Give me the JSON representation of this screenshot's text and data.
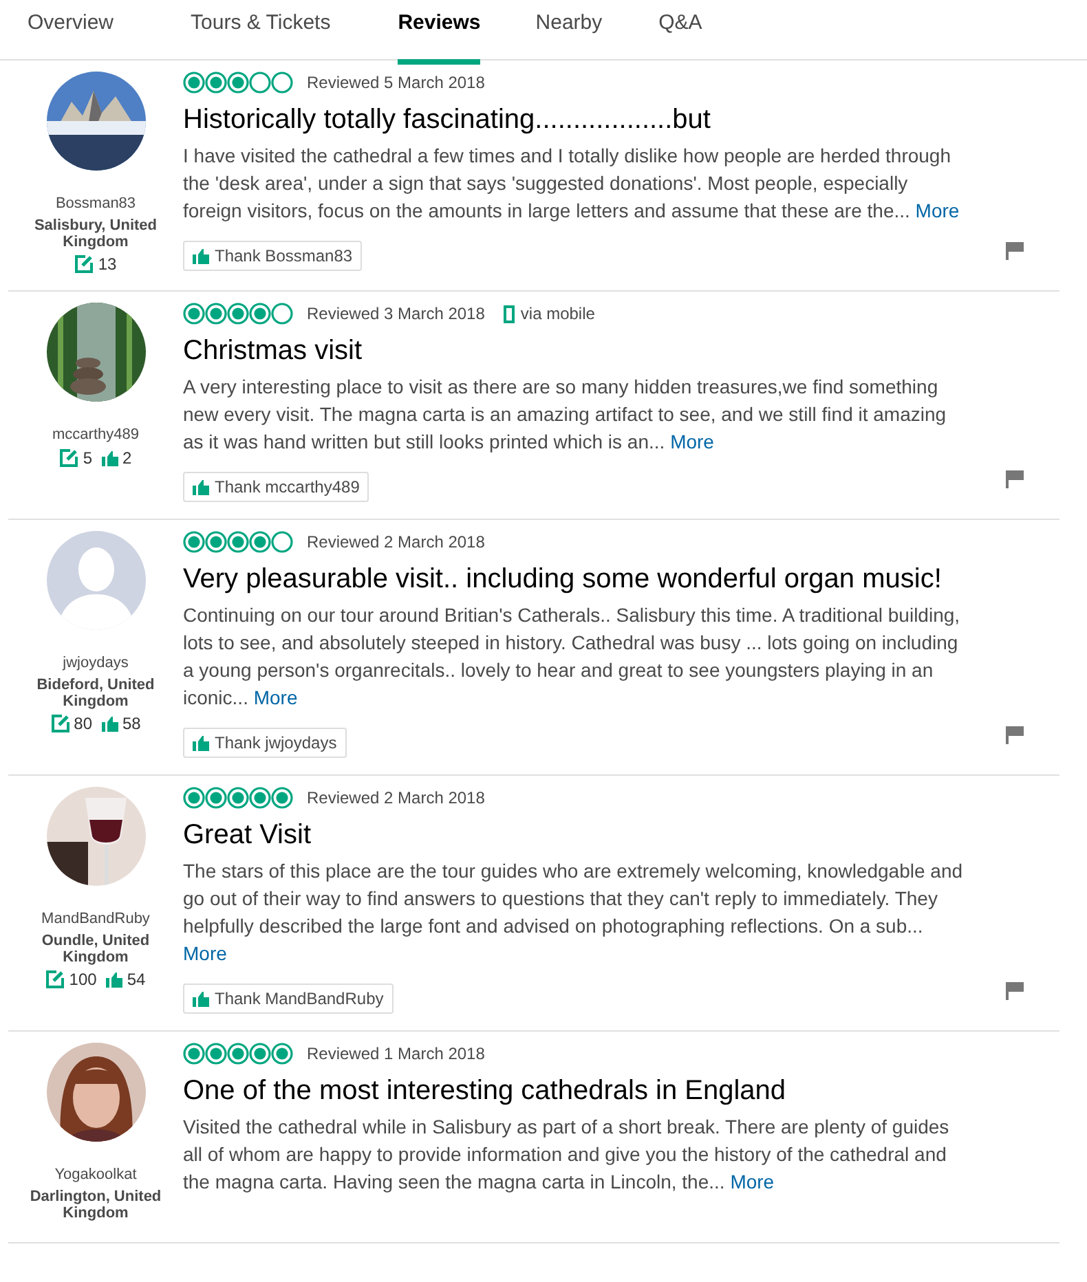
{
  "tabs": [
    {
      "label": "Overview",
      "selected": false
    },
    {
      "label": "Tours & Tickets",
      "selected": false
    },
    {
      "label": "Reviews",
      "selected": true
    },
    {
      "label": "Nearby",
      "selected": false
    },
    {
      "label": "Q&A",
      "selected": false
    }
  ],
  "reviews": [
    {
      "username": "Bossman83",
      "location": "Salisbury, United Kingdom",
      "review_count": "13",
      "stars": 3,
      "date": "Reviewed 5 March 2018",
      "title": "Historically totally fascinating..................but",
      "body": "I have visited the cathedral a few times and I totally dislike how people are herded through the 'desk area', under a sign that says 'suggested donations'. Most people, especially foreign visitors, focus on the amounts in large letters and assume that these are the...",
      "more": "More",
      "thank": "Thank Bossman83"
    },
    {
      "username": "mccarthy489",
      "review_count": "5",
      "helpful_count": "2",
      "stars": 4,
      "date": "Reviewed 3 March 2018",
      "via": "via mobile",
      "title": "Christmas visit",
      "body": "A very interesting place to visit as there are so many hidden treasures,we find something new every visit. The magna carta is an amazing artifact to see, and we still find it amazing as it was hand written but still looks printed which is an...",
      "more": "More",
      "thank": "Thank mccarthy489"
    },
    {
      "avatar": {
        "kind": "silhouette"
      },
      "username": "jwjoydays",
      "location": "Bideford, United Kingdom",
      "review_count": "80",
      "helpful_count": "58",
      "stars": 4,
      "date": "Reviewed 2 March 2018",
      "title": "Very pleasurable visit.. including some wonderful organ music!",
      "body": "Continuing on our tour around Britian's Catherals.. Salisbury this time. A traditional building, lots to see, and absolutely steeped in history. Cathedral was busy ... lots going on including a young person's organrecitals.. lovely to hear and great to see youngsters playing in an iconic...",
      "more": "More",
      "thank": "Thank jwjoydays"
    },
    {
      "username": "MandBandRuby",
      "location": "Oundle, United Kingdom",
      "review_count": "100",
      "helpful_count": "54",
      "stars": 5,
      "date": "Reviewed 2 March 2018",
      "title": "Great Visit",
      "body": "The stars of this place are the tour guides who are extremely welcoming, knowledgable and go out of their way to find answers to questions that they can't reply to immediately. They helpfully described the large font and advised on photographing reflections. On a sub...",
      "more": "More",
      "thank": "Thank MandBandRuby"
    },
    {
      "username": "Yogakoolkat",
      "location": "Darlington, United Kingdom",
      "stars": 5,
      "date": "Reviewed 1 March 2018",
      "title": "One of the most interesting cathedrals in England",
      "body": "Visited the cathedral while in Salisbury as part of a short break. There are plenty of guides all of whom are happy to provide information and give you the history of the cathedral and the magna carta. Having seen the magna carta in Lincoln, the...",
      "more": "More"
    }
  ]
}
